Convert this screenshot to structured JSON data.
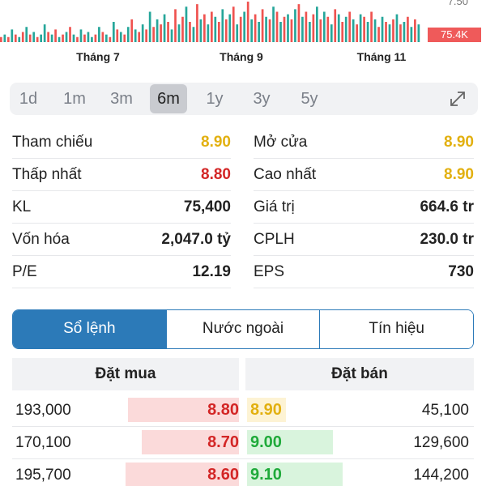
{
  "chart": {
    "price_tick": "7.50",
    "volume_badge": "75.4K",
    "up_color": "#26a69a",
    "down_color": "#ef5350",
    "bars": [
      [
        "d",
        2
      ],
      [
        "u",
        3
      ],
      [
        "d",
        2
      ],
      [
        "u",
        5
      ],
      [
        "d",
        3
      ],
      [
        "u",
        2
      ],
      [
        "d",
        4
      ],
      [
        "u",
        6
      ],
      [
        "d",
        3
      ],
      [
        "u",
        4
      ],
      [
        "d",
        2
      ],
      [
        "u",
        3
      ],
      [
        "u",
        7
      ],
      [
        "d",
        4
      ],
      [
        "u",
        3
      ],
      [
        "d",
        5
      ],
      [
        "u",
        2
      ],
      [
        "d",
        3
      ],
      [
        "u",
        4
      ],
      [
        "d",
        6
      ],
      [
        "u",
        3
      ],
      [
        "d",
        2
      ],
      [
        "u",
        5
      ],
      [
        "d",
        3
      ],
      [
        "u",
        4
      ],
      [
        "u",
        2
      ],
      [
        "d",
        3
      ],
      [
        "u",
        6
      ],
      [
        "d",
        4
      ],
      [
        "u",
        3
      ],
      [
        "d",
        2
      ],
      [
        "u",
        8
      ],
      [
        "d",
        5
      ],
      [
        "u",
        4
      ],
      [
        "d",
        3
      ],
      [
        "u",
        6
      ],
      [
        "d",
        9
      ],
      [
        "u",
        5
      ],
      [
        "d",
        4
      ],
      [
        "u",
        7
      ],
      [
        "d",
        5
      ],
      [
        "u",
        12
      ],
      [
        "d",
        6
      ],
      [
        "u",
        9
      ],
      [
        "d",
        7
      ],
      [
        "u",
        11
      ],
      [
        "d",
        8
      ],
      [
        "u",
        5
      ],
      [
        "d",
        13
      ],
      [
        "u",
        7
      ],
      [
        "d",
        10
      ],
      [
        "u",
        14
      ],
      [
        "d",
        8
      ],
      [
        "u",
        6
      ],
      [
        "d",
        15
      ],
      [
        "u",
        9
      ],
      [
        "d",
        11
      ],
      [
        "u",
        7
      ],
      [
        "d",
        12
      ],
      [
        "u",
        10
      ],
      [
        "d",
        8
      ],
      [
        "u",
        13
      ],
      [
        "d",
        9
      ],
      [
        "u",
        11
      ],
      [
        "d",
        14
      ],
      [
        "u",
        7
      ],
      [
        "d",
        10
      ],
      [
        "u",
        12
      ],
      [
        "d",
        16
      ],
      [
        "u",
        9
      ],
      [
        "d",
        11
      ],
      [
        "u",
        8
      ],
      [
        "d",
        13
      ],
      [
        "u",
        10
      ],
      [
        "d",
        9
      ],
      [
        "u",
        14
      ],
      [
        "d",
        12
      ],
      [
        "u",
        8
      ],
      [
        "d",
        10
      ],
      [
        "u",
        11
      ],
      [
        "d",
        9
      ],
      [
        "u",
        13
      ],
      [
        "d",
        15
      ],
      [
        "u",
        10
      ],
      [
        "d",
        12
      ],
      [
        "u",
        8
      ],
      [
        "d",
        11
      ],
      [
        "u",
        14
      ],
      [
        "d",
        9
      ],
      [
        "u",
        12
      ],
      [
        "d",
        10
      ],
      [
        "u",
        7
      ],
      [
        "d",
        13
      ],
      [
        "u",
        11
      ],
      [
        "d",
        8
      ],
      [
        "u",
        10
      ],
      [
        "d",
        12
      ],
      [
        "u",
        9
      ],
      [
        "d",
        7
      ],
      [
        "u",
        11
      ],
      [
        "d",
        10
      ],
      [
        "u",
        8
      ],
      [
        "d",
        12
      ],
      [
        "u",
        9
      ],
      [
        "d",
        6
      ],
      [
        "u",
        10
      ],
      [
        "d",
        8
      ],
      [
        "u",
        7
      ],
      [
        "d",
        9
      ],
      [
        "u",
        11
      ],
      [
        "d",
        7
      ],
      [
        "u",
        8
      ],
      [
        "d",
        10
      ],
      [
        "u",
        6
      ],
      [
        "d",
        9
      ],
      [
        "u",
        7
      ]
    ],
    "months": [
      "Tháng 7",
      "Tháng 9",
      "Tháng 11"
    ]
  },
  "ranges": [
    "1d",
    "1m",
    "3m",
    "6m",
    "1y",
    "3y",
    "5y"
  ],
  "active_range": "6m",
  "stats": [
    [
      {
        "label": "Tham chiếu",
        "value": "8.90",
        "color": "yellow"
      },
      {
        "label": "Mở cửa",
        "value": "8.90",
        "color": "yellow"
      }
    ],
    [
      {
        "label": "Thấp nhất",
        "value": "8.80",
        "color": "red"
      },
      {
        "label": "Cao nhất",
        "value": "8.90",
        "color": "yellow"
      }
    ],
    [
      {
        "label": "KL",
        "value": "75,400",
        "color": ""
      },
      {
        "label": "Giá trị",
        "value": "664.6 tr",
        "color": ""
      }
    ],
    [
      {
        "label": "Vốn hóa",
        "value": "2,047.0 tỷ",
        "color": ""
      },
      {
        "label": "CPLH",
        "value": "230.0 tr",
        "color": ""
      }
    ],
    [
      {
        "label": "P/E",
        "value": "12.19",
        "color": ""
      },
      {
        "label": "EPS",
        "value": "730",
        "color": ""
      }
    ]
  ],
  "segments": [
    "Sổ lệnh",
    "Nước ngoài",
    "Tín hiệu"
  ],
  "active_segment": "Sổ lệnh",
  "orderbook": {
    "buy_header": "Đặt mua",
    "sell_header": "Đặt bán",
    "rows": [
      {
        "buy_vol": "193,000",
        "buy_price": "8.80",
        "buy_fill": 0.49,
        "sell_price": "8.90",
        "sell_vol": "45,100",
        "sell_fill": 0.17,
        "sell_color": "yellow"
      },
      {
        "buy_vol": "170,100",
        "buy_price": "8.70",
        "buy_fill": 0.43,
        "sell_price": "9.00",
        "sell_vol": "129,600",
        "sell_fill": 0.38,
        "sell_color": "green"
      },
      {
        "buy_vol": "195,700",
        "buy_price": "8.60",
        "buy_fill": 0.5,
        "sell_price": "9.10",
        "sell_vol": "144,200",
        "sell_fill": 0.42,
        "sell_color": "green"
      }
    ]
  }
}
